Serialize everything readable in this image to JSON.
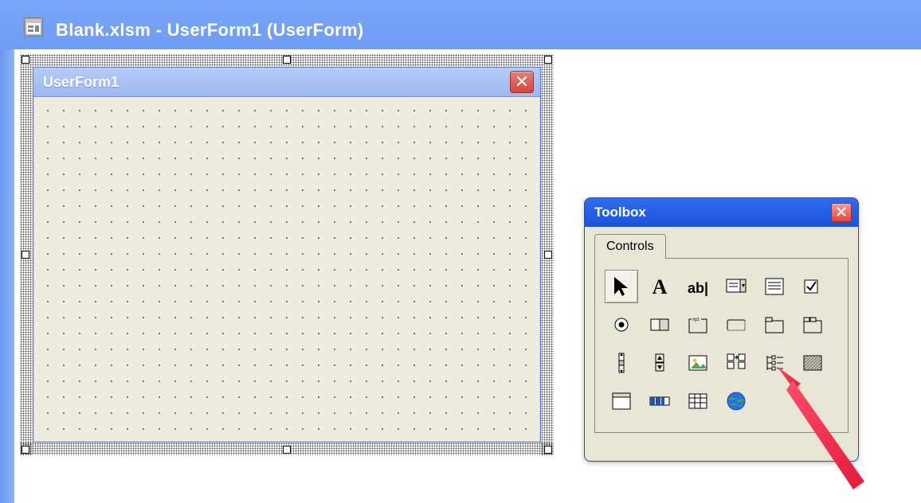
{
  "mdi": {
    "title": "Blank.xlsm - UserForm1 (UserForm)"
  },
  "userform": {
    "title": "UserForm1"
  },
  "toolbox": {
    "title": "Toolbox",
    "tab": "Controls",
    "tools": [
      {
        "name": "select-objects-icon",
        "glyph": "pointer",
        "selected": true
      },
      {
        "name": "label-icon",
        "glyph": "labelA",
        "selected": false
      },
      {
        "name": "textbox-icon",
        "glyph": "textbox",
        "selected": false
      },
      {
        "name": "combobox-icon",
        "glyph": "combobox",
        "selected": false
      },
      {
        "name": "listbox-icon",
        "glyph": "listbox",
        "selected": false
      },
      {
        "name": "checkbox-icon",
        "glyph": "checkbox",
        "selected": false
      },
      {
        "name": "optionbutton-icon",
        "glyph": "option",
        "selected": false
      },
      {
        "name": "togglebutton-icon",
        "glyph": "toggle",
        "selected": false
      },
      {
        "name": "frame-icon",
        "glyph": "frame",
        "selected": false
      },
      {
        "name": "commandbutton-icon",
        "glyph": "button",
        "selected": false
      },
      {
        "name": "tabstrip-icon",
        "glyph": "tabstrip",
        "selected": false
      },
      {
        "name": "multipage-icon",
        "glyph": "multipage",
        "selected": false
      },
      {
        "name": "scrollbar-icon",
        "glyph": "scrollbar",
        "selected": false
      },
      {
        "name": "spinbutton-icon",
        "glyph": "spin",
        "selected": false
      },
      {
        "name": "image-icon",
        "glyph": "image",
        "selected": false
      },
      {
        "name": "refedit-icon",
        "glyph": "refedit",
        "selected": false
      },
      {
        "name": "treeview-icon",
        "glyph": "treeview",
        "selected": false
      },
      {
        "name": "imagelist-icon",
        "glyph": "imagelist",
        "selected": false
      },
      {
        "name": "listview-icon",
        "glyph": "listview",
        "selected": false
      },
      {
        "name": "progressbar-icon",
        "glyph": "progress",
        "selected": false
      },
      {
        "name": "datepicker-icon",
        "glyph": "datetime",
        "selected": false
      },
      {
        "name": "webbrowser-icon",
        "glyph": "globe",
        "selected": false
      }
    ]
  }
}
